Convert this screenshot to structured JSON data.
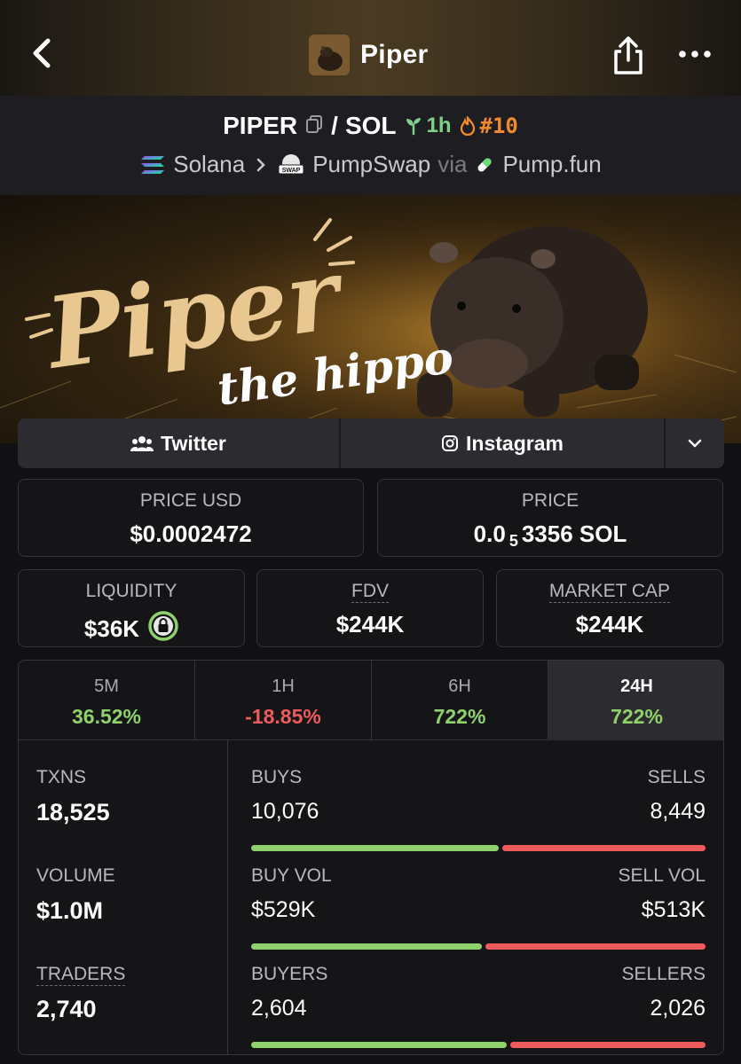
{
  "header": {
    "title": "Piper",
    "icons": {
      "back": "chevron-left-icon",
      "share": "share-icon",
      "more": "more-dots-icon"
    }
  },
  "pair": {
    "base": "PIPER",
    "separator": "/",
    "quote": "SOL",
    "age": "1h",
    "rank": "#10",
    "chain": "Solana",
    "dex": "PumpSwap",
    "via_label": "via",
    "launchpad": "Pump.fun",
    "dex_badge": "SWAP"
  },
  "banner": {
    "title": "Piper",
    "subtitle": "the hippo"
  },
  "social": {
    "twitter": "Twitter",
    "instagram": "Instagram"
  },
  "prices": {
    "price_usd_label": "PRICE USD",
    "price_usd": "$0.0002472",
    "price_label": "PRICE",
    "price_lead": "0.0",
    "price_zeros": "5",
    "price_rest": "3356 SOL"
  },
  "metrics": {
    "liquidity_label": "LIQUIDITY",
    "liquidity": "$36K",
    "fdv_label": "FDV",
    "fdv": "$244K",
    "mcap_label": "MARKET CAP",
    "mcap": "$244K"
  },
  "tabs": [
    {
      "label": "5M",
      "value": "36.52%",
      "dir": "up"
    },
    {
      "label": "1H",
      "value": "-18.85%",
      "dir": "down"
    },
    {
      "label": "6H",
      "value": "722%",
      "dir": "up"
    },
    {
      "label": "24H",
      "value": "722%",
      "dir": "up",
      "active": true
    }
  ],
  "stats": {
    "txns_label": "TXNS",
    "txns": "18,525",
    "volume_label": "VOLUME",
    "volume": "$1.0M",
    "traders_label": "TRADERS",
    "traders": "2,740",
    "buys_label": "BUYS",
    "buys": "10,076",
    "sells_label": "SELLS",
    "sells": "8,449",
    "buy_vol_label": "BUY VOL",
    "buy_vol": "$529K",
    "sell_vol_label": "SELL VOL",
    "sell_vol": "$513K",
    "buyers_label": "BUYERS",
    "buyers": "2,604",
    "sellers_label": "SELLERS",
    "sellers": "2,026",
    "buys_share": 0.544,
    "buy_vol_share": 0.508,
    "buyers_share": 0.562
  },
  "colors": {
    "up": "#8fd16a",
    "down": "#ef5b5b",
    "rank": "#f08a2a",
    "age": "#7fd18a"
  }
}
